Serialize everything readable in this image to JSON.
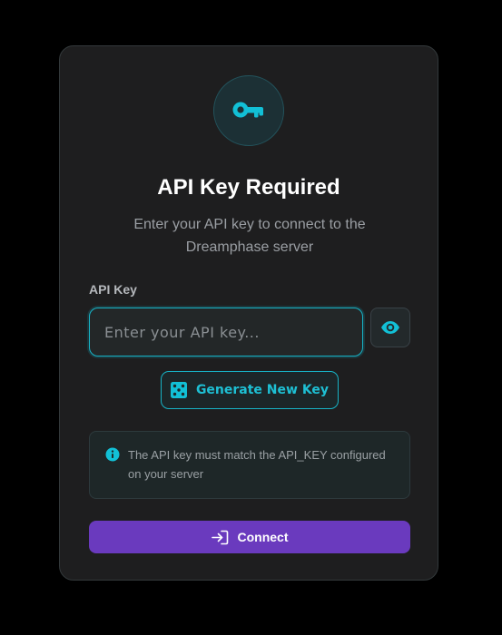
{
  "dialog": {
    "title": "API Key Required",
    "subtitle": "Enter your API key to connect to the Dreamphase server",
    "key_icon": "key-icon"
  },
  "form": {
    "api_key_label": "API Key",
    "api_key_value": "",
    "api_key_placeholder": "Enter your API key...",
    "toggle_icon": "eye-icon",
    "generate_label": "Generate New Key",
    "generate_icon": "dice-icon"
  },
  "info": {
    "icon": "info-icon",
    "text": "The API key must match the API_KEY configured on your server"
  },
  "actions": {
    "connect_label": "Connect",
    "connect_icon": "sign-in-icon"
  },
  "colors": {
    "accent": "#17b3c6",
    "primary_button": "#6a3abe",
    "card_background": "#1e1e1f",
    "page_background": "#000000"
  }
}
